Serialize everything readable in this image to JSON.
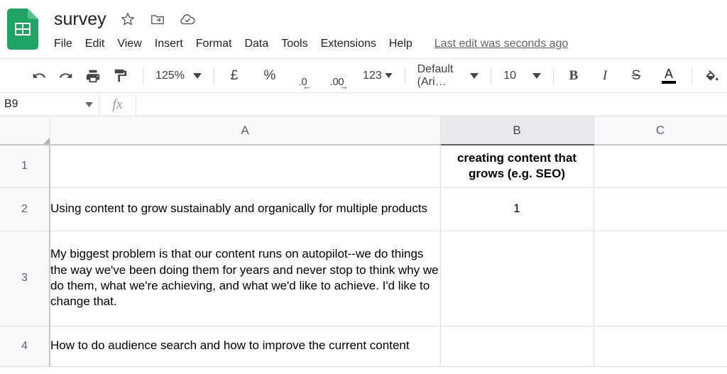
{
  "app": {
    "logo_icon": "google-sheets-logo",
    "doc_title": "survey",
    "title_icons": [
      {
        "name": "star-icon",
        "label": "Star"
      },
      {
        "name": "move-to-folder-icon",
        "label": "Move"
      },
      {
        "name": "cloud-saved-icon",
        "label": "Saved to Drive"
      }
    ],
    "last_edit": "Last edit was seconds ago"
  },
  "menubar": {
    "items": [
      "File",
      "Edit",
      "View",
      "Insert",
      "Format",
      "Data",
      "Tools",
      "Extensions",
      "Help"
    ]
  },
  "toolbar": {
    "undo": {
      "icon": "undo-icon",
      "label": "Undo"
    },
    "redo": {
      "icon": "redo-icon",
      "label": "Redo"
    },
    "print": {
      "icon": "print-icon",
      "label": "Print"
    },
    "paint_format": {
      "icon": "paint-format-icon",
      "label": "Paint format"
    },
    "zoom_value": "125%",
    "currency": {
      "icon": "pound-sterling-icon",
      "label": "£"
    },
    "percent": {
      "icon": "percent-icon",
      "label": "%"
    },
    "decrease_decimal": {
      "icon": "decrease-decimal-icon",
      "num": ".0",
      "arrow": "←"
    },
    "increase_decimal": {
      "icon": "increase-decimal-icon",
      "num": ".00",
      "arrow": "→"
    },
    "number_format": "123",
    "font_family": "Default (Ari…",
    "font_size": "10",
    "bold": "B",
    "italic": "I",
    "strikethrough": "S",
    "text_color": {
      "icon": "text-color-icon",
      "glyph": "A",
      "color": "#000000"
    },
    "fill_color": {
      "icon": "fill-color-icon",
      "label": "Fill color"
    }
  },
  "formula_bar": {
    "name_box_value": "B9",
    "fx_label": "fx",
    "formula_value": "",
    "formula_placeholder": ""
  },
  "grid": {
    "columns": [
      "A",
      "B",
      "C"
    ],
    "selected_column": "B",
    "rows": [
      {
        "num": "1",
        "a": "",
        "b": "creating content that grows (e.g. SEO)",
        "b_bold": true,
        "c": ""
      },
      {
        "num": "2",
        "a": "Using content to grow sustainably and organically for multiple products",
        "b": "1",
        "b_bold": false,
        "c": ""
      },
      {
        "num": "3",
        "a": "My biggest problem is that our content runs on autopilot--we do things the way we've been doing them for years and never stop to think why we do them, what we're achieving, and what we'd like to achieve. I'd like to change that.",
        "b": "",
        "b_bold": false,
        "c": ""
      },
      {
        "num": "4",
        "a": "How to do audience search and how to improve the current content",
        "b": "",
        "b_bold": false,
        "c": ""
      }
    ]
  },
  "colors": {
    "brand_green": "#21a366",
    "header_bg": "#f8f9fa",
    "selected_header_bg": "#e8eaed",
    "grid_line": "#e0e0e0",
    "text_primary": "#202124",
    "text_secondary": "#5f6368"
  }
}
